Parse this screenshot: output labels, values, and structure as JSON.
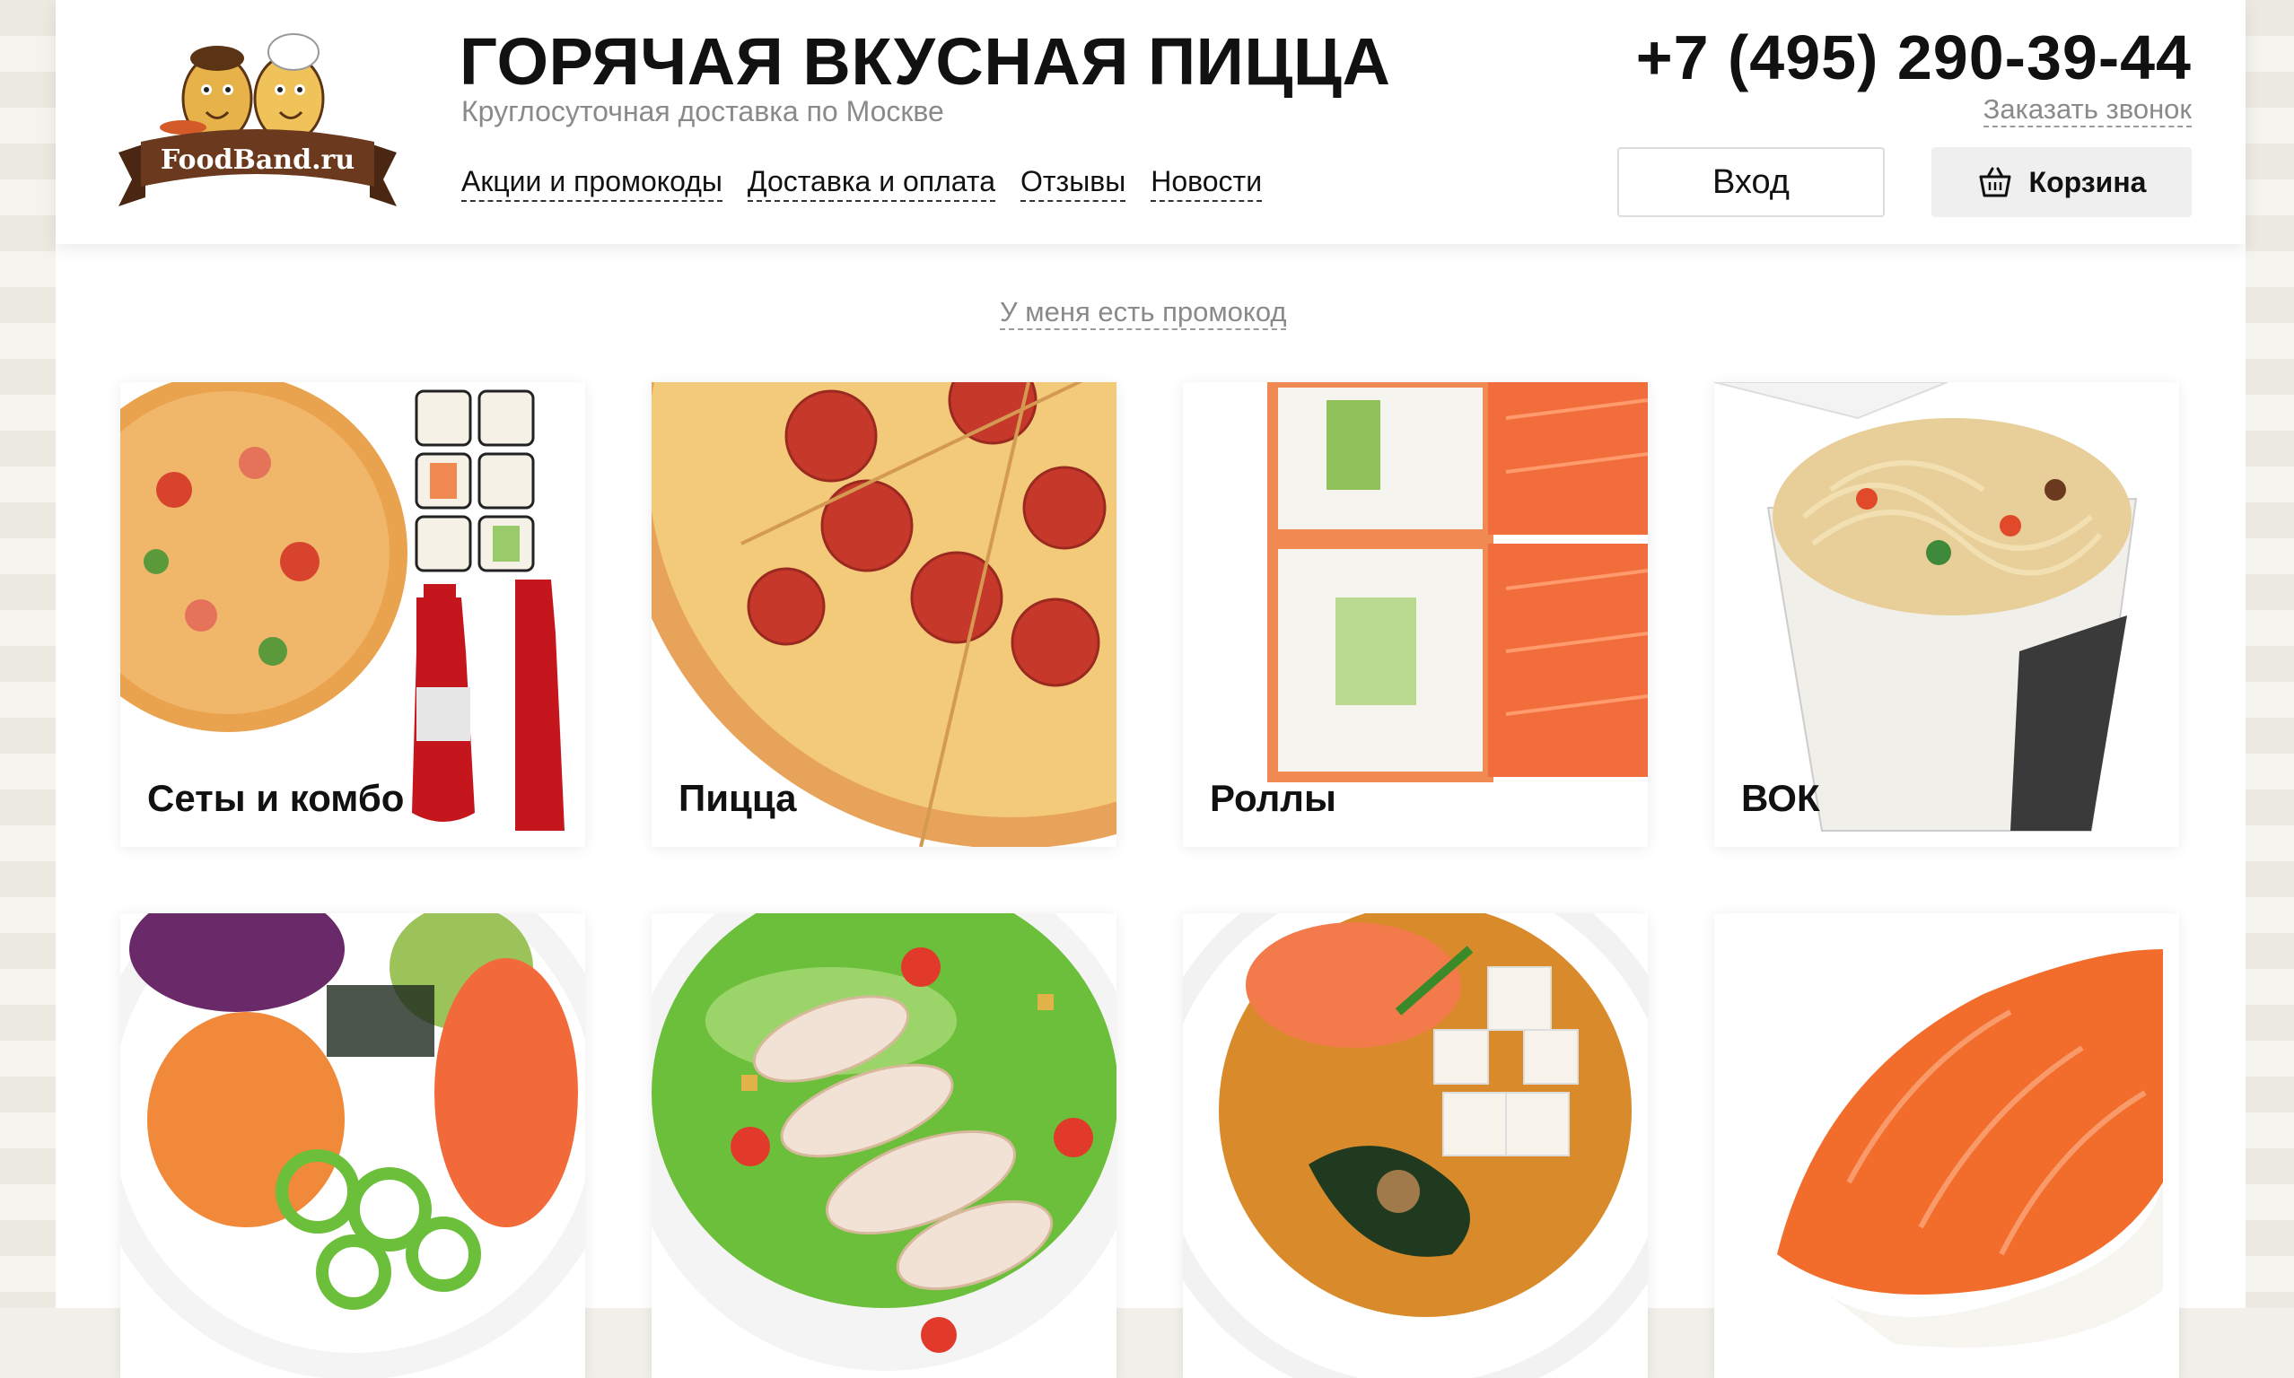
{
  "header": {
    "logo_text": "FoodBand.ru",
    "title": "ГОРЯЧАЯ ВКУСНАЯ ПИЦЦА",
    "subtitle": "Круглосуточная доставка по Москве",
    "nav": [
      {
        "label": "Акции и промокоды"
      },
      {
        "label": "Доставка и оплата"
      },
      {
        "label": "Отзывы"
      },
      {
        "label": "Новости"
      }
    ],
    "phone": "+7 (495) 290-39-44",
    "callback_label": "Заказать звонок",
    "login_label": "Вход",
    "cart_label": "Корзина",
    "cart_icon": "basket-icon"
  },
  "promo_label": "У меня есть промокод",
  "categories": [
    {
      "label": "Сеты и комбо",
      "icon": "combo-image"
    },
    {
      "label": "Пицца",
      "icon": "pizza-image"
    },
    {
      "label": "Роллы",
      "icon": "rolls-image"
    },
    {
      "label": "ВОК",
      "icon": "wok-image"
    },
    {
      "label": "",
      "icon": "poke-image"
    },
    {
      "label": "",
      "icon": "salad-image"
    },
    {
      "label": "",
      "icon": "soup-image"
    },
    {
      "label": "",
      "icon": "sushi-image"
    }
  ],
  "colors": {
    "logo_ribbon": "#6b3a1e",
    "accent_orange": "#f07a3a",
    "text_muted": "#8a8a8a"
  }
}
